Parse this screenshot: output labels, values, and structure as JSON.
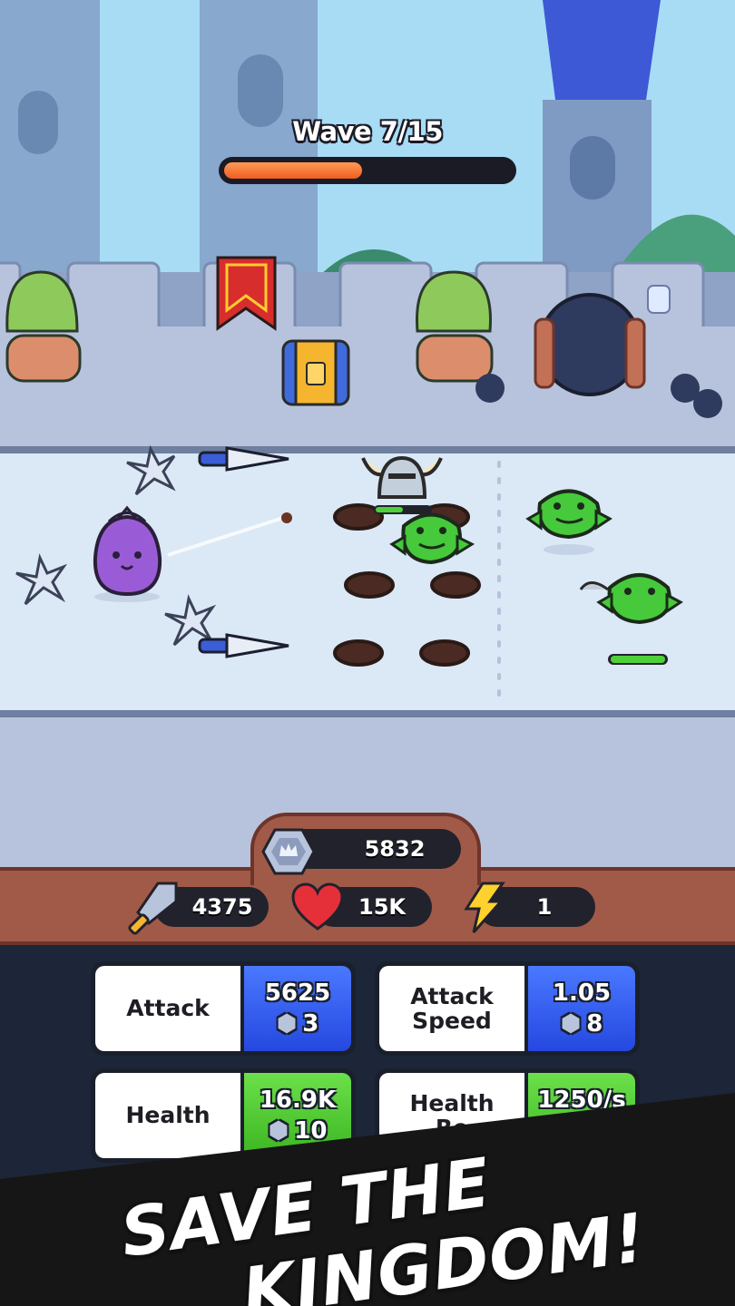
{
  "wave": {
    "label": "Wave 7/15",
    "progress": 0.48
  },
  "currency": {
    "gems": "5832"
  },
  "stats": {
    "attack": "4375",
    "health": "15K",
    "energy": "1"
  },
  "upgrades": [
    {
      "name": "Attack",
      "value": "5625",
      "cost": "3",
      "color": "#2f55ea"
    },
    {
      "name_line1": "Attack",
      "name_line2": "Speed",
      "value": "1.05",
      "cost": "8",
      "color": "#2f55ea"
    },
    {
      "name": "Health",
      "value": "16.9K",
      "cost": "10",
      "color": "#46c22a"
    },
    {
      "name_line1": "Health",
      "name_line2": "Re",
      "value": "1250/s",
      "color": "#46c22a"
    }
  ],
  "banner": {
    "line1": "SAVE THE",
    "line2": "KINGDOM!"
  },
  "colors": {
    "sky": "#a8dcf5",
    "wall": "#b7c3dc",
    "path": "#dbe8f6",
    "panel": "#a15a48",
    "enemy": "#46c93a",
    "hero": "#9a5cd6"
  }
}
